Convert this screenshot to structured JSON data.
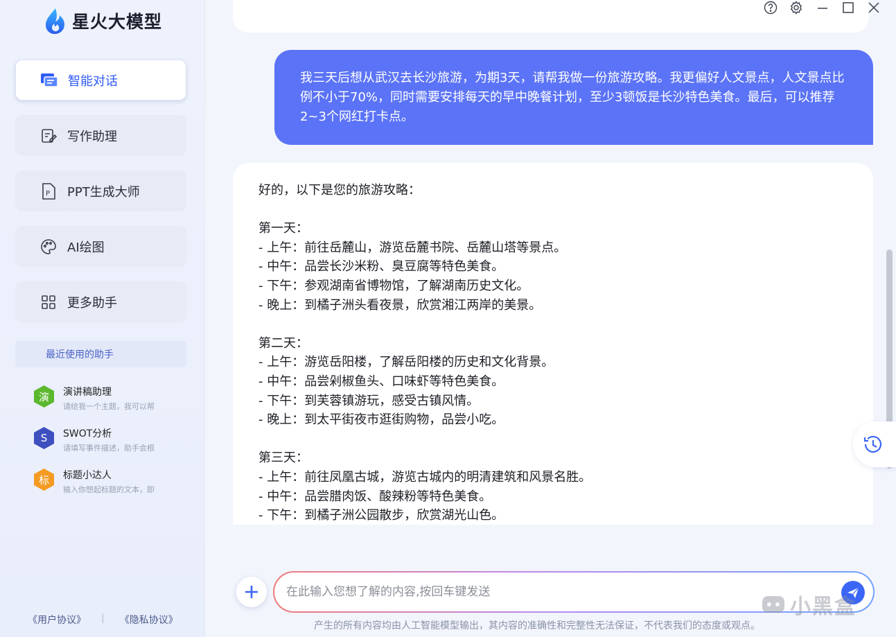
{
  "app": {
    "title": "星火大模型"
  },
  "sidebar": {
    "nav": [
      {
        "label": "智能对话",
        "icon": "chat-icon",
        "active": true
      },
      {
        "label": "写作助理",
        "icon": "edit-icon",
        "active": false
      },
      {
        "label": "PPT生成大师",
        "icon": "ppt-icon",
        "active": false
      },
      {
        "label": "AI绘图",
        "icon": "palette-icon",
        "active": false
      },
      {
        "label": "更多助手",
        "icon": "grid-icon",
        "active": false
      }
    ],
    "recent_header": "最近使用的助手",
    "recent": [
      {
        "badge": "演",
        "title": "演讲稿助理",
        "desc": "请给我一个主题，我可以帮",
        "color": "#5cb82e"
      },
      {
        "badge": "S",
        "title": "SWOT分析",
        "desc": "请填写事件描述，助手会根",
        "color": "#3e4fc0"
      },
      {
        "badge": "标",
        "title": "标题小达人",
        "desc": "输入你想起标题的文本，即",
        "color": "#f59a23"
      }
    ],
    "footer": {
      "user_agreement": "《用户协议》",
      "separator": "|",
      "privacy": "《隐私协议》"
    }
  },
  "chat": {
    "user_message": "我三天后想从武汉去长沙旅游，为期3天，请帮我做一份旅游攻略。我更偏好人文景点，人文景点比例不小于70%，同时需要安排每天的早中晚餐计划，至少3顿饭是长沙特色美食。最后，可以推荐2~3个网红打卡点。",
    "ai_lines": [
      "好的，以下是您的旅游攻略：",
      "",
      "第一天：",
      "- 上午：前往岳麓山，游览岳麓书院、岳麓山塔等景点。",
      "- 中午：品尝长沙米粉、臭豆腐等特色美食。",
      "- 下午：参观湖南省博物馆，了解湖南历史文化。",
      "- 晚上：到橘子洲头看夜景，欣赏湘江两岸的美景。",
      "",
      "第二天：",
      "- 上午：游览岳阳楼，了解岳阳楼的历史和文化背景。",
      "- 中午：品尝剁椒鱼头、口味虾等特色美食。",
      "- 下午：到芙蓉镇游玩，感受古镇风情。",
      "- 晚上：到太平街夜市逛街购物，品尝小吃。",
      "",
      "第三天：",
      "- 上午：前往凤凰古城，游览古城内的明清建筑和风景名胜。",
      "- 中午：品尝腊肉饭、酸辣粉等特色美食。",
      "- 下午：到橘子洲公园散步，欣赏湖光山色。"
    ]
  },
  "input": {
    "placeholder": "在此输入您想了解的内容,按回车键发送",
    "value": ""
  },
  "disclaimer": "产生的所有内容均由人工智能模型输出，其内容的准确性和完整性无法保证，不代表我们的态度或观点。",
  "watermark": {
    "brand": "小黑盒"
  },
  "colors": {
    "accent": "#2f5bf4",
    "user_bubble": "#5b73f6",
    "send": "#3b66f5"
  }
}
